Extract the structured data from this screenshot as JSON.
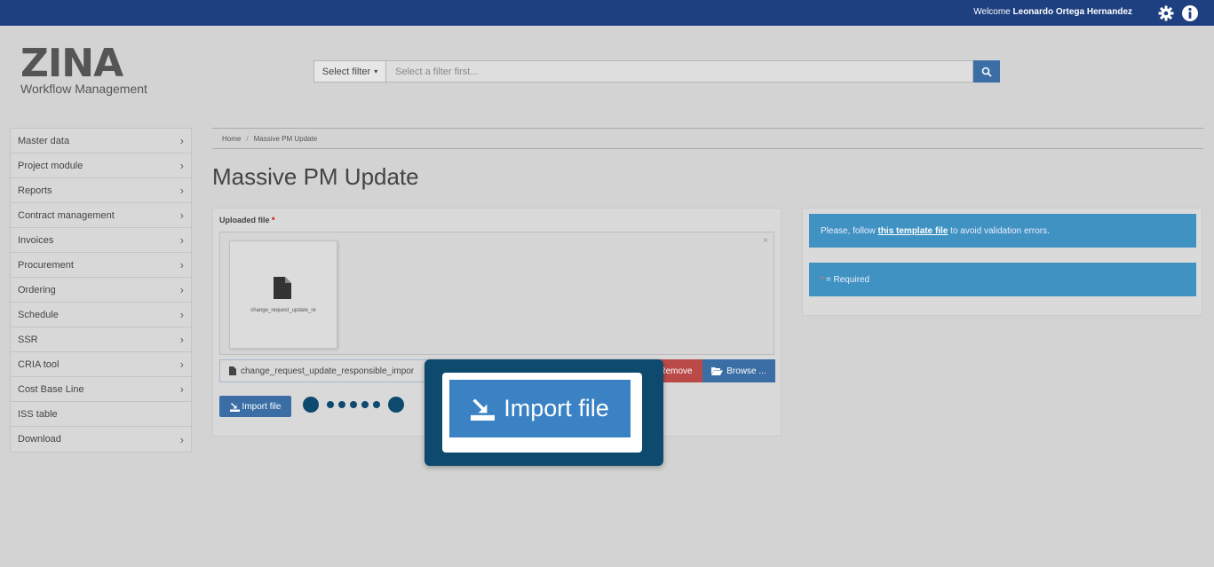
{
  "header": {
    "welcome_prefix": "Welcome",
    "user_name": "Leonardo Ortega Hernandez",
    "bar_color": "#1f4080"
  },
  "logo": {
    "name": "ZINA",
    "subtitle": "Workflow Management"
  },
  "search": {
    "filter_label": "Select filter",
    "placeholder": "Select a filter first..."
  },
  "sidebar": {
    "items": [
      {
        "label": "Master data",
        "has_children": true
      },
      {
        "label": "Project module",
        "has_children": true
      },
      {
        "label": "Reports",
        "has_children": true
      },
      {
        "label": "Contract management",
        "has_children": true
      },
      {
        "label": "Invoices",
        "has_children": true
      },
      {
        "label": "Procurement",
        "has_children": true
      },
      {
        "label": "Ordering",
        "has_children": true
      },
      {
        "label": "Schedule",
        "has_children": true
      },
      {
        "label": "SSR",
        "has_children": true
      },
      {
        "label": "CRIA tool",
        "has_children": true
      },
      {
        "label": "Cost Base Line",
        "has_children": true
      },
      {
        "label": "ISS table",
        "has_children": false
      },
      {
        "label": "Download",
        "has_children": true
      }
    ]
  },
  "breadcrumb": {
    "home": "Home",
    "separator": "/",
    "current": "Massive PM Update"
  },
  "page": {
    "title": "Massive PM Update"
  },
  "upload": {
    "label": "Uploaded file",
    "required_mark": "*",
    "close_symbol": "×",
    "thumb_name": "change_request_update_re",
    "file_field_value": "change_request_update_responsible_impor",
    "remove_label": "Remove",
    "browse_label": "Browse ...",
    "import_label": "Import file"
  },
  "info": {
    "template_prefix": "Please, follow",
    "template_link": "this template file",
    "template_suffix": "to avoid validation errors.",
    "required_star": "*",
    "required_text": "= Required"
  },
  "callout": {
    "label": "Import file"
  }
}
